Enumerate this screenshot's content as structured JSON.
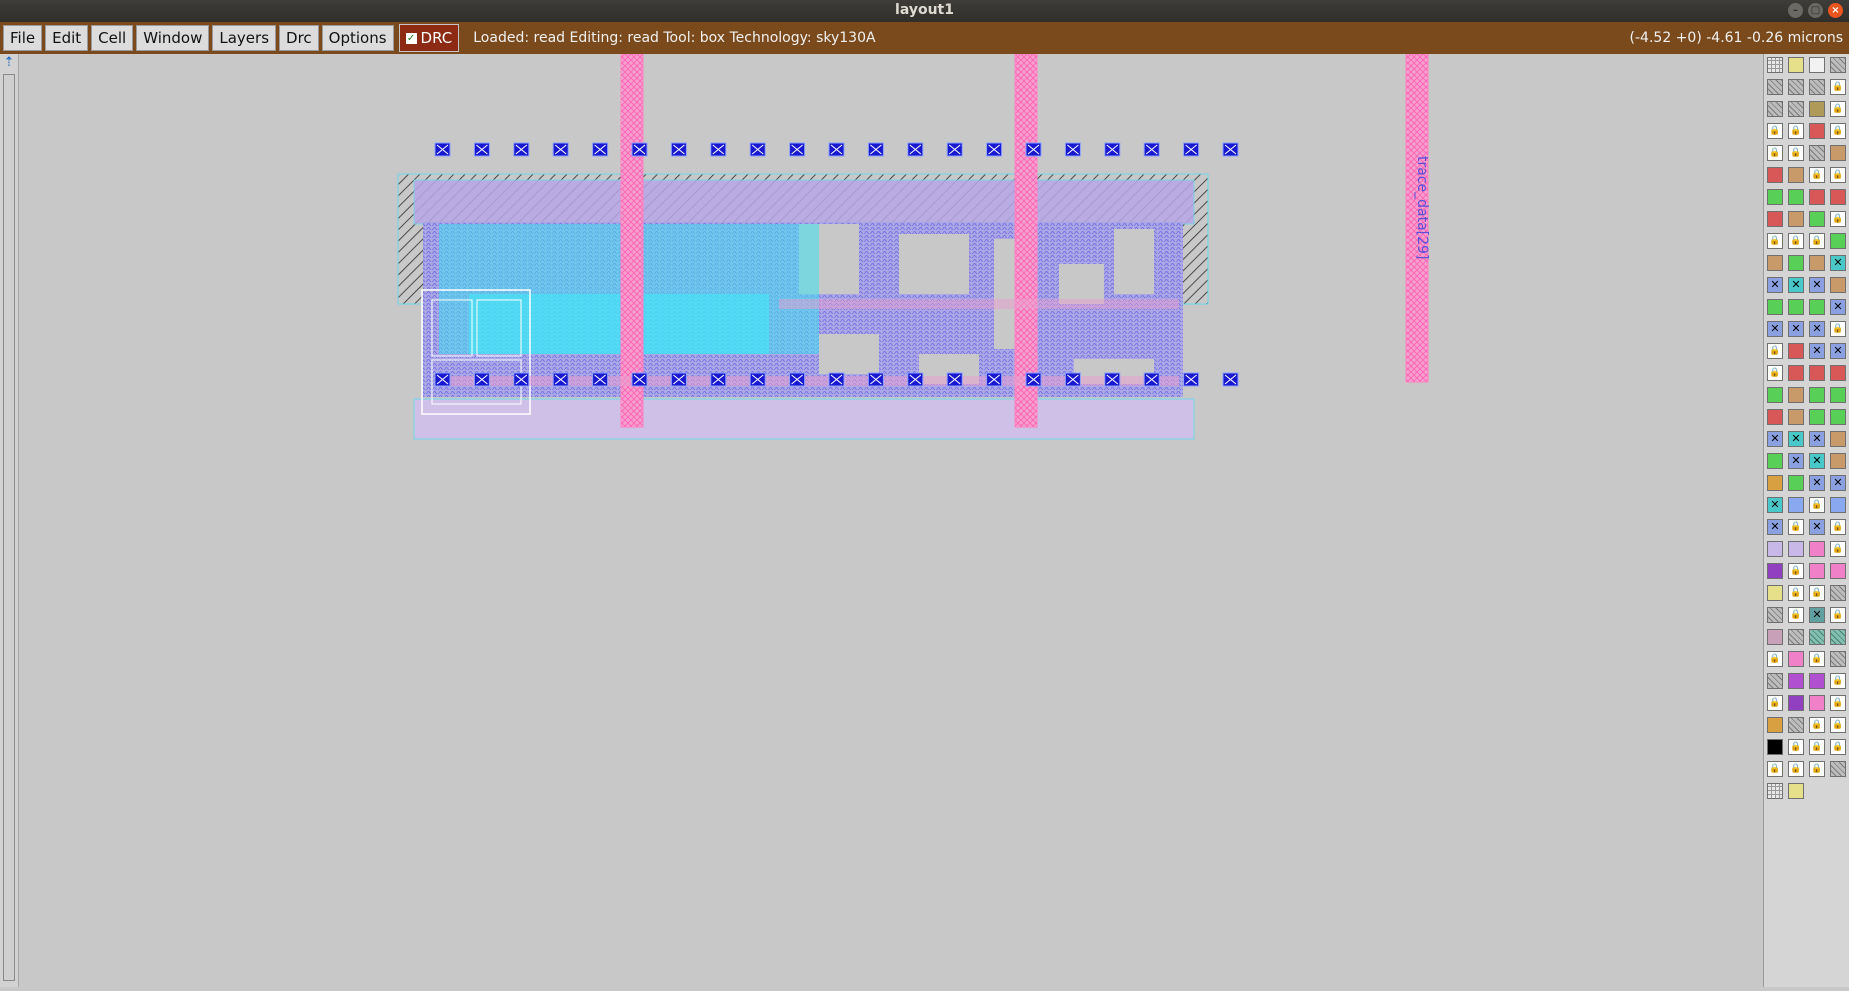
{
  "window": {
    "title": "layout1"
  },
  "menu": [
    "File",
    "Edit",
    "Cell",
    "Window",
    "Layers",
    "Drc",
    "Options"
  ],
  "drc": {
    "label": "DRC",
    "checked": true
  },
  "status": {
    "text": "Loaded: read Editing: read Tool: box  Technology: sky130A"
  },
  "coords": {
    "text": "(-4.52 +0) -4.61 -0.26 microns"
  },
  "canvas": {
    "net_labels": [
      "trace_data[29]"
    ],
    "colors": {
      "background": "#c8c8c8",
      "local_interconnect": "#8a78f0",
      "metal1": "#3fe0f0",
      "metal2": "#ff88c8",
      "contact": "#1818d0",
      "rail": "#cfc0e8"
    }
  },
  "palette": {
    "rows": [
      [
        "grid",
        "solid-yellow",
        "outline",
        "hatch-gray"
      ],
      [
        "hatch-gray",
        "hatch-gray",
        "hatch-gray",
        "lock"
      ],
      [
        "hatch-gray",
        "hatch-gray",
        "solid-olive",
        "lock"
      ],
      [
        "lock",
        "lock",
        "solid-red",
        "lock"
      ],
      [
        "lock",
        "lock",
        "hatch-gray",
        "solid-brown"
      ],
      [
        "solid-red",
        "solid-brown",
        "lock",
        "lock"
      ],
      [
        "solid-green",
        "solid-green",
        "solid-red",
        "solid-red"
      ],
      [
        "solid-red",
        "solid-brown",
        "solid-green",
        "lock"
      ],
      [
        "lock",
        "lock",
        "lock",
        "solid-green"
      ],
      [
        "solid-brown",
        "solid-green",
        "solid-brown",
        "cross-cyan"
      ],
      [
        "cross-blue",
        "cross-cyan",
        "cross-blue",
        "solid-brown"
      ],
      [
        "solid-green",
        "solid-green",
        "solid-green",
        "cross-blue"
      ],
      [
        "cross-blue",
        "cross-blue",
        "cross-blue",
        "lock"
      ],
      [
        "lock",
        "solid-red",
        "cross-blue",
        "cross-blue"
      ],
      [
        "lock",
        "solid-red",
        "solid-red",
        "solid-red"
      ],
      [
        "solid-green",
        "solid-brown",
        "solid-green",
        "solid-green"
      ],
      [
        "solid-red",
        "solid-brown",
        "solid-green",
        "solid-green"
      ],
      [
        "cross-blue",
        "cross-cyan",
        "cross-blue",
        "solid-brown"
      ],
      [
        "solid-green",
        "cross-blue",
        "cross-cyan",
        "solid-brown"
      ],
      [
        "solid-orange",
        "solid-green",
        "cross-blue",
        "cross-blue"
      ],
      [
        "cross-cyan",
        "solid-blue",
        "lock",
        "solid-blue"
      ],
      [
        "cross-blue",
        "lock",
        "cross-blue",
        "lock"
      ],
      [
        "solid-lilac",
        "solid-lilac",
        "solid-pink",
        "lock"
      ],
      [
        "solid-purple",
        "lock",
        "solid-pink",
        "solid-pink"
      ],
      [
        "solid-yellow",
        "lock",
        "lock",
        "hatch-gray"
      ],
      [
        "hatch-gray",
        "lock",
        "cross-teal",
        "lock"
      ],
      [
        "solid-mauve",
        "hatch-gray",
        "hatch-teal",
        "hatch-teal"
      ],
      [
        "lock",
        "solid-pink",
        "lock",
        "hatch-gray"
      ],
      [
        "hatch-gray",
        "solid-violet",
        "solid-violet",
        "lock"
      ],
      [
        "lock",
        "solid-purple",
        "solid-pink",
        "lock"
      ],
      [
        "solid-orange",
        "hatch-gray",
        "lock",
        "lock"
      ],
      [
        "solid-black",
        "lock",
        "lock",
        "lock"
      ],
      [
        "lock",
        "lock",
        "lock",
        "hatch-gray"
      ],
      [
        "grid",
        "solid-yellow"
      ]
    ],
    "colors": {
      "grid": "#e8e8e8",
      "outline": "#f2f2f2",
      "hatch-gray": "#bdbdbd",
      "solid-yellow": "#e7e08a",
      "solid-olive": "#b09a5a",
      "solid-red": "#d85858",
      "solid-brown": "#c89a6a",
      "solid-green": "#58d058",
      "cross-cyan": "#48c8c8",
      "cross-blue": "#8aa0e0",
      "solid-orange": "#d8a040",
      "solid-blue": "#8aa8f0",
      "solid-lilac": "#c8b8e8",
      "solid-pink": "#f080c8",
      "solid-purple": "#9040c0",
      "cross-teal": "#60a0a0",
      "solid-mauve": "#c8a0b8",
      "hatch-teal": "#80c0b0",
      "solid-violet": "#b050d0",
      "solid-black": "#000000",
      "lock": "#ffffff"
    }
  }
}
